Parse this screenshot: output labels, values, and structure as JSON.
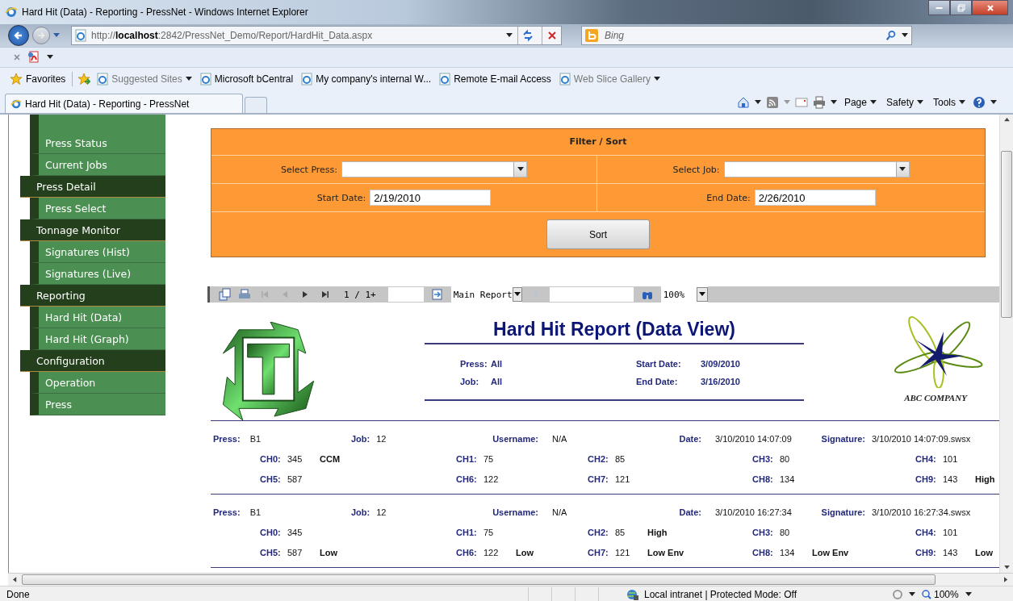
{
  "window": {
    "title": "Hard Hit (Data) - Reporting - PressNet - Windows Internet Explorer"
  },
  "address_bar": {
    "url": "http://**localhost**:2842/PressNet_Demo/Report/HardHit_Data.aspx"
  },
  "search": {
    "placeholder": "Bing"
  },
  "favorites_bar": {
    "label": "Favorites",
    "links": [
      {
        "label": "Suggested Sites",
        "dimmed": true,
        "dropdown": true
      },
      {
        "label": "Microsoft bCentral",
        "dimmed": false,
        "dropdown": false
      },
      {
        "label": "My company's internal W...",
        "dimmed": false,
        "dropdown": false
      },
      {
        "label": "Remote E-mail Access",
        "dimmed": false,
        "dropdown": false
      },
      {
        "label": "Web Slice Gallery",
        "dimmed": true,
        "dropdown": true
      }
    ]
  },
  "tabs": [
    {
      "label": "Hard Hit (Data) - Reporting - PressNet",
      "selected": true
    }
  ],
  "command_bar": {
    "menus": [
      "Page",
      "Safety",
      "Tools"
    ]
  },
  "sidebar": {
    "sections": [
      {
        "children": [
          "Press Status",
          "Current Jobs"
        ]
      },
      {
        "label": "Press Detail",
        "children": [
          "Press Select"
        ]
      },
      {
        "label": "Tonnage Monitor",
        "children": [
          "Signatures (Hist)",
          "Signatures (Live)"
        ]
      },
      {
        "label": "Reporting",
        "children": [
          "Hard Hit (Data)",
          "Hard Hit (Graph)"
        ]
      },
      {
        "label": "Configuration",
        "children": [
          "Operation",
          "Press"
        ]
      }
    ]
  },
  "filter": {
    "title": "Filter / Sort",
    "fields": [
      {
        "label": "Select Press:",
        "kind": "select"
      },
      {
        "label": "Select Job:",
        "kind": "select"
      },
      {
        "label": "Start Date:",
        "kind": "date",
        "value": "2/19/2010"
      },
      {
        "label": "End Date:",
        "kind": "date",
        "value": "2/26/2010"
      }
    ],
    "button": "Sort"
  },
  "report_toolbar": {
    "page": "1 / 1+",
    "report_select": "Main Report",
    "zoom": "100%"
  },
  "report": {
    "title": "Hard Hit Report (Data View)",
    "info": [
      {
        "label": "Press:",
        "value": "All"
      },
      {
        "label": "Start Date:",
        "value": "3/09/2010"
      },
      {
        "label": "Job:",
        "value": "All"
      },
      {
        "label": "End Date:",
        "value": "3/16/2010"
      }
    ],
    "company": "ABC COMPANY"
  },
  "records": [
    {
      "fields": [
        {
          "label": "Press:",
          "value": "B1"
        },
        {
          "label": "Job:",
          "value": "12"
        },
        {
          "label": "Username:",
          "value": "N/A"
        },
        {
          "label": "Date:",
          "value": "3/10/2010 14:07:09"
        },
        {
          "label": "Signature:",
          "value": "3/10/2010 14:07:09.swsx"
        }
      ],
      "channels": [
        {
          "label": "CH0:",
          "value": "345",
          "flag": "CCM"
        },
        {
          "label": "CH1:",
          "value": "75"
        },
        {
          "label": "CH2:",
          "value": "85"
        },
        {
          "label": "CH3:",
          "value": "80"
        },
        {
          "label": "CH4:",
          "value": "101"
        },
        {
          "label": "CH5:",
          "value": "587"
        },
        {
          "label": "CH6:",
          "value": "122"
        },
        {
          "label": "CH7:",
          "value": "121"
        },
        {
          "label": "CH8:",
          "value": "134"
        },
        {
          "label": "CH9:",
          "value": "143",
          "flag": "High"
        }
      ]
    },
    {
      "fields": [
        {
          "label": "Press:",
          "value": "B1"
        },
        {
          "label": "Job:",
          "value": "12"
        },
        {
          "label": "Username:",
          "value": "N/A"
        },
        {
          "label": "Date:",
          "value": "3/10/2010 16:27:34"
        },
        {
          "label": "Signature:",
          "value": "3/10/2010 16:27:34.swsx"
        }
      ],
      "channels": [
        {
          "label": "CH0:",
          "value": "345"
        },
        {
          "label": "CH1:",
          "value": "75"
        },
        {
          "label": "CH2:",
          "value": "85",
          "flag": "High"
        },
        {
          "label": "CH3:",
          "value": "80"
        },
        {
          "label": "CH4:",
          "value": "101"
        },
        {
          "label": "CH5:",
          "value": "587",
          "flag": "Low"
        },
        {
          "label": "CH6:",
          "value": "122",
          "flag": "Low"
        },
        {
          "label": "CH7:",
          "value": "121",
          "flag": "Low Env"
        },
        {
          "label": "CH8:",
          "value": "134",
          "flag": "Low Env"
        },
        {
          "label": "CH9:",
          "value": "143",
          "flag": "Low"
        }
      ]
    }
  ],
  "status_bar": {
    "text": "Done",
    "zone": "Local intranet | Protected Mode: Off",
    "zoom": "100%"
  }
}
